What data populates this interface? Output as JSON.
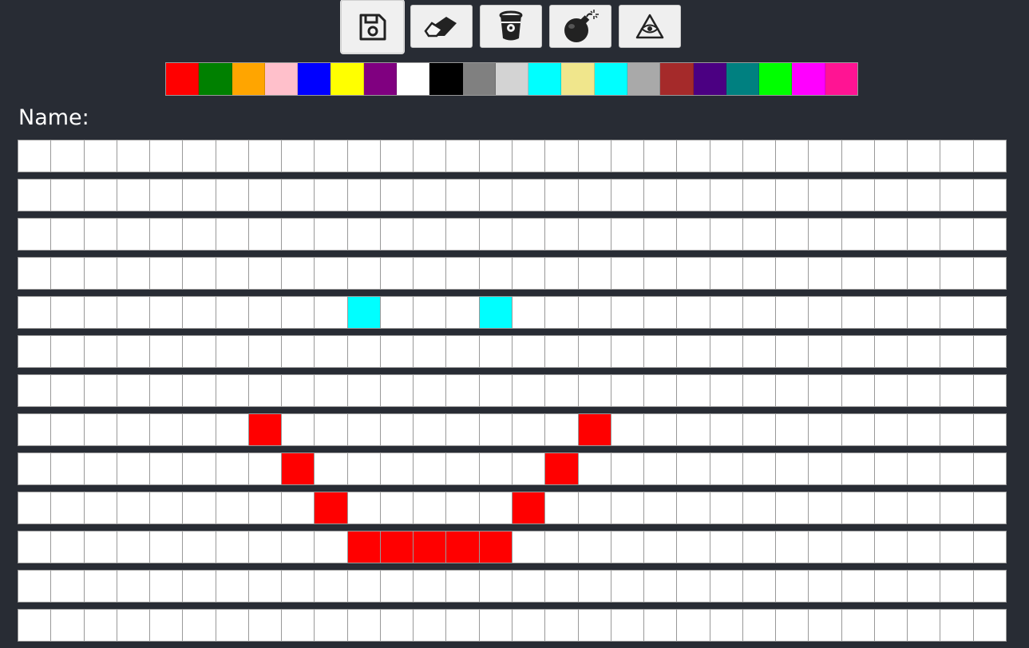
{
  "toolbar": {
    "tools": [
      {
        "name": "save-icon",
        "active": true
      },
      {
        "name": "eraser-icon",
        "active": false
      },
      {
        "name": "bucket-icon",
        "active": false
      },
      {
        "name": "bomb-icon",
        "active": false
      },
      {
        "name": "triangle-eye-icon",
        "active": false
      }
    ]
  },
  "palette": [
    "#ff0000",
    "#008000",
    "#ffa500",
    "#ffc0cb",
    "#0000ff",
    "#ffff00",
    "#800080",
    "#ffffff",
    "#000000",
    "#808080",
    "#d3d3d3",
    "#00ffff",
    "#f0e68c",
    "#00ffff",
    "#a9a9a9",
    "#a52a2a",
    "#4b0082",
    "#008080",
    "#00ff00",
    "#ff00ff",
    "#ff1493"
  ],
  "name_label": "Name:",
  "grid": {
    "rows": 13,
    "cols": 30,
    "default_color": "#ffffff",
    "painted": [
      {
        "row": 4,
        "col": 10,
        "color": "#00ffff"
      },
      {
        "row": 4,
        "col": 14,
        "color": "#00ffff"
      },
      {
        "row": 7,
        "col": 7,
        "color": "#ff0000"
      },
      {
        "row": 7,
        "col": 17,
        "color": "#ff0000"
      },
      {
        "row": 8,
        "col": 8,
        "color": "#ff0000"
      },
      {
        "row": 8,
        "col": 16,
        "color": "#ff0000"
      },
      {
        "row": 9,
        "col": 9,
        "color": "#ff0000"
      },
      {
        "row": 9,
        "col": 15,
        "color": "#ff0000"
      },
      {
        "row": 10,
        "col": 10,
        "color": "#ff0000"
      },
      {
        "row": 10,
        "col": 11,
        "color": "#ff0000"
      },
      {
        "row": 10,
        "col": 12,
        "color": "#ff0000"
      },
      {
        "row": 10,
        "col": 13,
        "color": "#ff0000"
      },
      {
        "row": 10,
        "col": 14,
        "color": "#ff0000"
      }
    ]
  }
}
